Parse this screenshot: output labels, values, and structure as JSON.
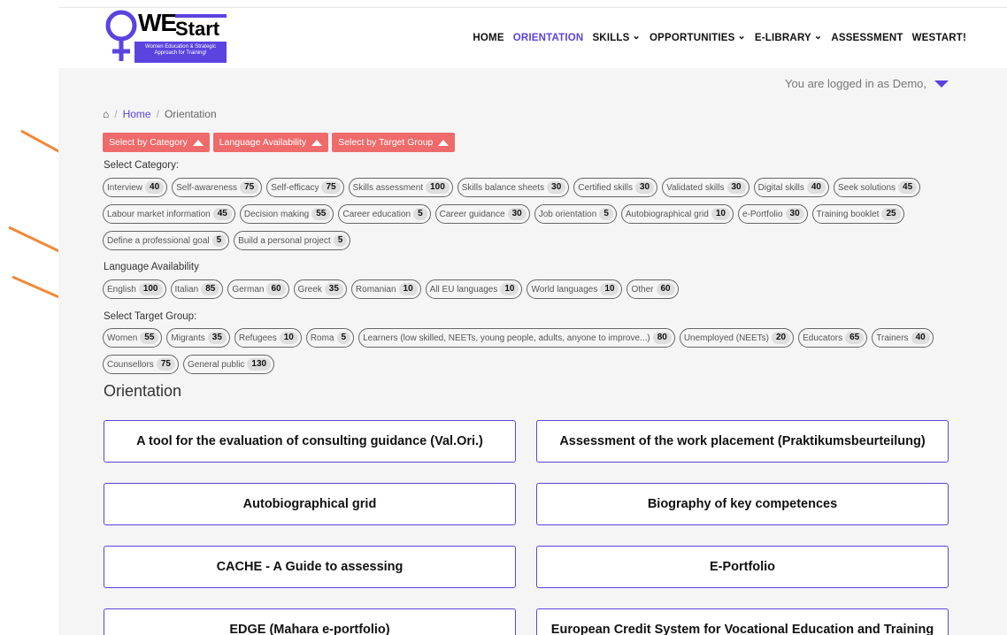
{
  "logo": {
    "word1": "WE",
    "word2": "Start",
    "tagline": "Women Education & Strategic Approach for Training!"
  },
  "nav": [
    {
      "label": "HOME",
      "active": false,
      "dropdown": false
    },
    {
      "label": "ORIENTATION",
      "active": true,
      "dropdown": false
    },
    {
      "label": "SKILLS",
      "active": false,
      "dropdown": true
    },
    {
      "label": "OPPORTUNITIES",
      "active": false,
      "dropdown": true
    },
    {
      "label": "E-LIBRARY",
      "active": false,
      "dropdown": true
    },
    {
      "label": "ASSESSMENT",
      "active": false,
      "dropdown": false
    },
    {
      "label": "WESTART!",
      "active": false,
      "dropdown": false
    }
  ],
  "user": {
    "logged_text": "You are logged in as Demo,"
  },
  "breadcrumb": {
    "home": "Home",
    "current": "Orientation"
  },
  "filters": [
    "Select by Category",
    "Language Availability",
    "Select by Target Group"
  ],
  "sections": {
    "category": "Select Category:",
    "language": "Language Availability",
    "target": "Select Target Group:"
  },
  "categories": [
    {
      "label": "Interview",
      "count": "40"
    },
    {
      "label": "Self-awareness",
      "count": "75"
    },
    {
      "label": "Self-efficacy",
      "count": "75"
    },
    {
      "label": "Skills assessment",
      "count": "100"
    },
    {
      "label": "Skills balance sheets",
      "count": "30"
    },
    {
      "label": "Certified skills",
      "count": "30"
    },
    {
      "label": "Validated skills",
      "count": "30"
    },
    {
      "label": "Digital skills",
      "count": "40"
    },
    {
      "label": "Seek solutions",
      "count": "45"
    },
    {
      "label": "Labour market information",
      "count": "45"
    },
    {
      "label": "Decision making",
      "count": "55"
    },
    {
      "label": "Career education",
      "count": "5"
    },
    {
      "label": "Career guidance",
      "count": "30"
    },
    {
      "label": "Job orientation",
      "count": "5"
    },
    {
      "label": "Autobiographical grid",
      "count": "10"
    },
    {
      "label": "e-Portfolio",
      "count": "30"
    },
    {
      "label": "Training booklet",
      "count": "25"
    },
    {
      "label": "Define a professional goal",
      "count": "5"
    },
    {
      "label": "Build a personal project",
      "count": "5"
    }
  ],
  "languages": [
    {
      "label": "English",
      "count": "100"
    },
    {
      "label": "Italian",
      "count": "85"
    },
    {
      "label": "German",
      "count": "60"
    },
    {
      "label": "Greek",
      "count": "35"
    },
    {
      "label": "Romanian",
      "count": "10"
    },
    {
      "label": "All EU languages",
      "count": "10"
    },
    {
      "label": "World languages",
      "count": "10"
    },
    {
      "label": "Other",
      "count": "60"
    }
  ],
  "targets": [
    {
      "label": "Women",
      "count": "55"
    },
    {
      "label": "Migrants",
      "count": "35"
    },
    {
      "label": "Refugees",
      "count": "10"
    },
    {
      "label": "Roma",
      "count": "5"
    },
    {
      "label": "Learners (low skilled, NEETs, young people, adults, anyone to improve...)",
      "count": "80"
    },
    {
      "label": "Unemployed (NEETs)",
      "count": "20"
    },
    {
      "label": "Educators",
      "count": "65"
    },
    {
      "label": "Trainers",
      "count": "40"
    },
    {
      "label": "Counsellors",
      "count": "75"
    },
    {
      "label": "General public",
      "count": "130"
    }
  ],
  "orientation_title": "Orientation",
  "tools": [
    "A tool for the evaluation of consulting guidance (Val.Ori.)",
    "Assessment of the work placement (Praktikumsbeurteilung)",
    "Autobiographical grid",
    "Biography of key competences",
    "CACHE - A Guide to assessing",
    "E-Portfolio",
    "EDGE (Mahara e-portfolio)",
    "European Credit System for Vocational Education and Training"
  ],
  "colors": {
    "accent": "#5b43e0",
    "filter": "#ef6b6b",
    "annotation_arrow": "#ef8a3a"
  }
}
